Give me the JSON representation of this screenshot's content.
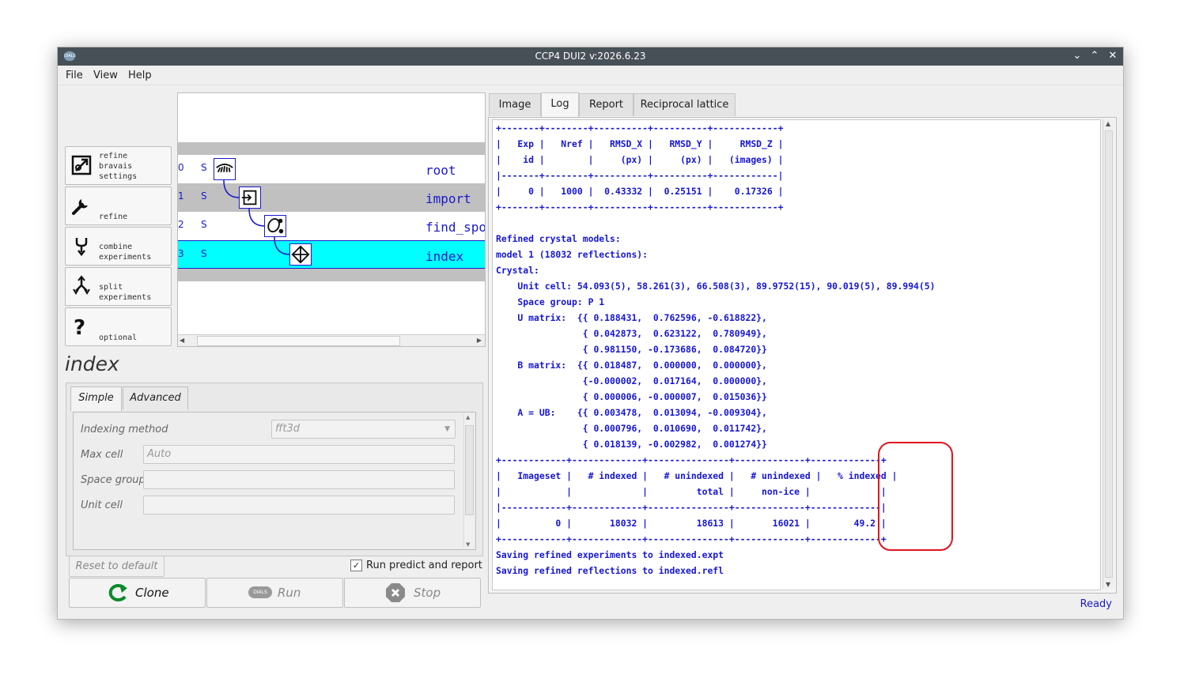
{
  "window": {
    "title": "CCP4 DUI2 v:2026.6.23",
    "app_icon_text": "DIALS",
    "minimize_glyph": "⌄",
    "maximize_glyph": "⌃",
    "close_glyph": "✕"
  },
  "menu": {
    "file": "File",
    "view": "View",
    "help": "Help"
  },
  "commands": [
    {
      "label": "refine\nbravais\nsettings",
      "icon": "refine-bravais-icon"
    },
    {
      "label": "refine",
      "icon": "wrench-icon"
    },
    {
      "label": "combine\nexperiments",
      "icon": "combine-icon"
    },
    {
      "label": "split\nexperiments",
      "icon": "split-icon"
    },
    {
      "label": "optional",
      "icon": "question-icon"
    }
  ],
  "tree": {
    "nodes": [
      {
        "num": "0",
        "status": "S",
        "label": "root",
        "icon": "root-icon"
      },
      {
        "num": "1",
        "status": "S",
        "label": "import",
        "icon": "import-icon"
      },
      {
        "num": "2",
        "status": "S",
        "label": "find_spots",
        "icon": "find-spots-icon"
      },
      {
        "num": "3",
        "status": "S",
        "label": "index",
        "icon": "index-icon"
      }
    ]
  },
  "step_title": "index",
  "params": {
    "tab_simple": "Simple",
    "tab_advanced": "Advanced",
    "indexing_method_label": "Indexing method",
    "indexing_method_value": "fft3d",
    "max_cell_label": "Max cell",
    "max_cell_placeholder": "Auto",
    "space_group_label": "Space group",
    "space_group_value": "",
    "unit_cell_label": "Unit cell",
    "unit_cell_value": ""
  },
  "controls": {
    "reset_label": "Reset to default",
    "run_predict_label": "Run predict and report",
    "run_predict_checked": true,
    "clone_label": "Clone",
    "run_label": "Run",
    "run_icon_text": "DIALS",
    "stop_label": "Stop"
  },
  "right_tabs": [
    "Image",
    "Log",
    "Report",
    "Reciprocal lattice"
  ],
  "active_right_tab": "Log",
  "log_lines": [
    "+-------+--------+----------+----------+------------+",
    "|   Exp |   Nref |   RMSD_X |   RMSD_Y |     RMSD_Z |",
    "|    id |        |     (px) |     (px) |   (images) |",
    "|-------+--------+----------+----------+------------|",
    "|     0 |   1000 |  0.43332 |  0.25151 |    0.17326 |",
    "+-------+--------+----------+----------+------------+",
    "",
    "Refined crystal models:",
    "model 1 (18032 reflections):",
    "Crystal:",
    "    Unit cell: 54.093(5), 58.261(3), 66.508(3), 89.9752(15), 90.019(5), 89.994(5)",
    "    Space group: P 1",
    "    U matrix:  {{ 0.188431,  0.762596, -0.618822},",
    "                { 0.042873,  0.623122,  0.780949},",
    "                { 0.981150, -0.173686,  0.084720}}",
    "    B matrix:  {{ 0.018487,  0.000000,  0.000000},",
    "                {-0.000002,  0.017164,  0.000000},",
    "                { 0.000006, -0.000007,  0.015036}}",
    "    A = UB:    {{ 0.003478,  0.013094, -0.009304},",
    "                { 0.000796,  0.010690,  0.011742},",
    "                { 0.018139, -0.002982,  0.001274}}",
    "+------------+-------------+---------------+-------------+-------------+",
    "|   Imageset |   # indexed |   # unindexed |   # unindexed |   % indexed |",
    "|            |             |         total |     non-ice |             |",
    "|------------+-------------+---------------+-------------+-------------|",
    "|          0 |       18032 |         18613 |       16021 |        49.2 |",
    "+------------+-------------+---------------+-------------+-------------+",
    "Saving refined experiments to indexed.expt",
    "Saving refined reflections to indexed.refl"
  ],
  "status": "Ready",
  "colors": {
    "accent_cyan": "#00ffff",
    "log_blue": "#1616d8",
    "highlight_red": "#e0141e"
  }
}
